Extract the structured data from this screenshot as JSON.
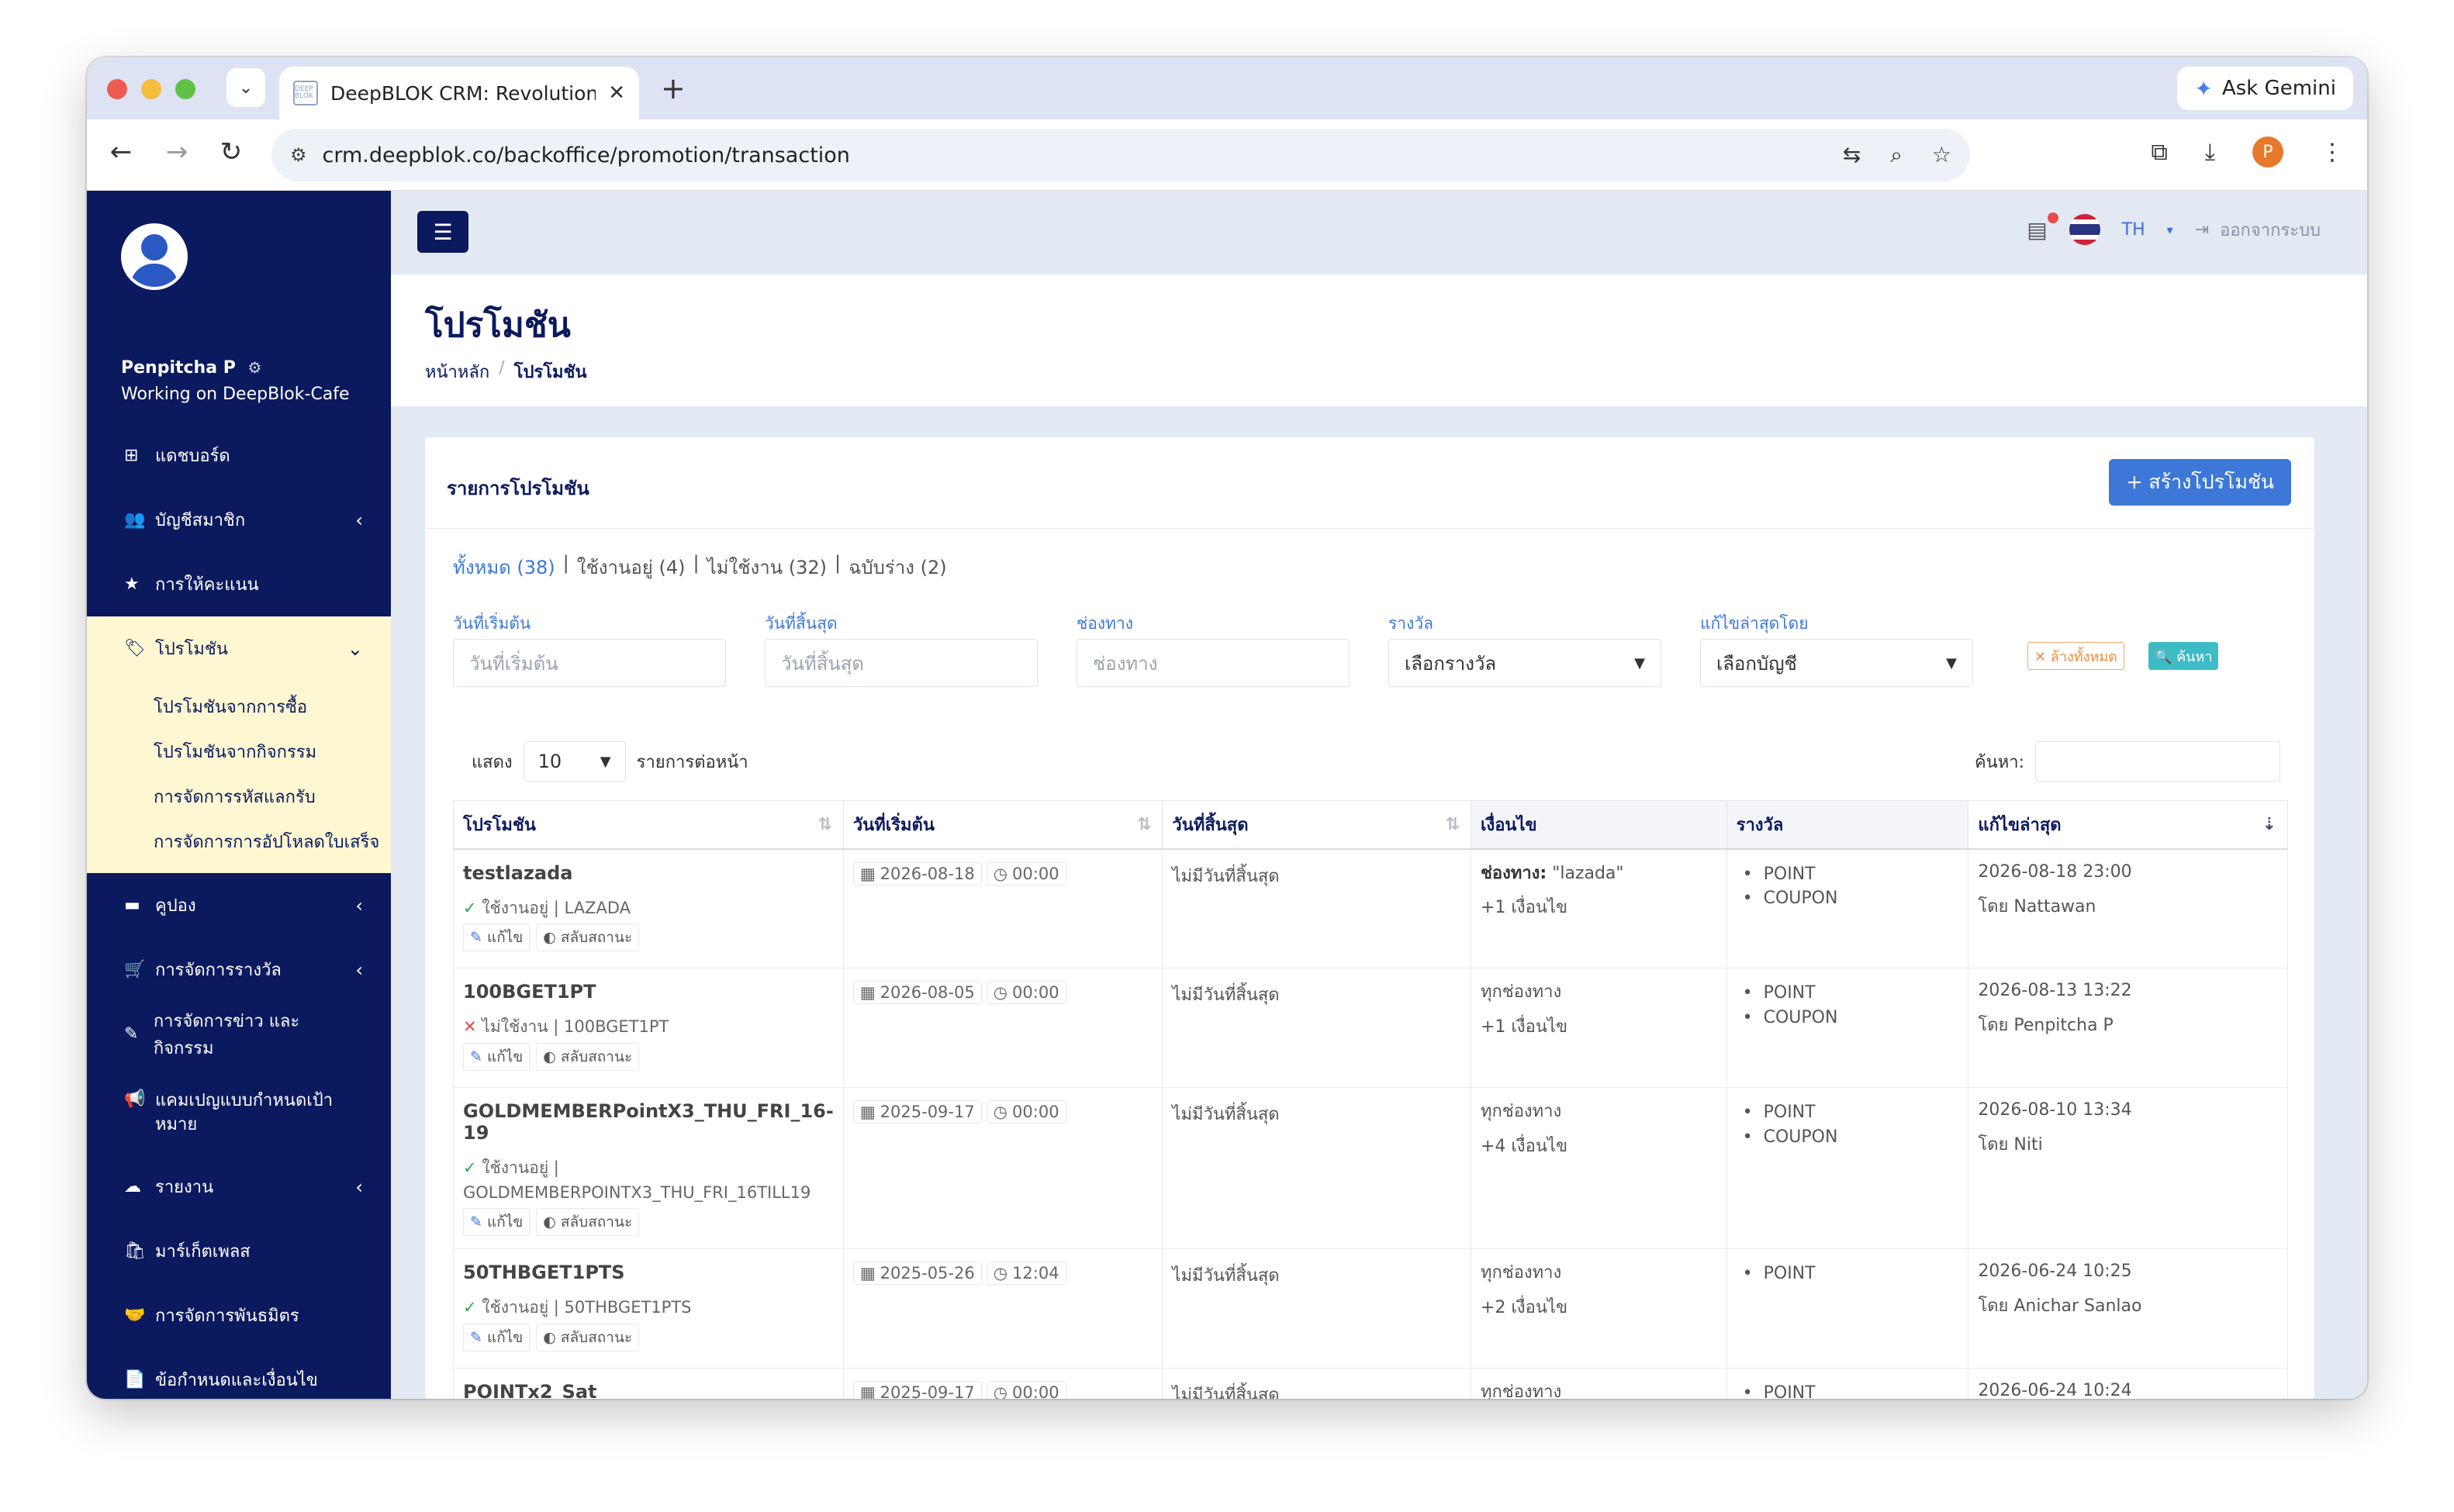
{
  "browser": {
    "tab_title": "DeepBLOK CRM: Revolutioniz",
    "favicon_text": "DEEP BLOK",
    "ask_gemini": "Ask Gemini",
    "url": "crm.deepblok.co/backoffice/promotion/transaction",
    "profile_initial": "P"
  },
  "sidebar": {
    "user_name": "Penpitcha P",
    "working_on": "Working on DeepBlok-Cafe",
    "items": [
      {
        "label": "แดชบอร์ด",
        "icon": "grid-icon",
        "glyph": "⊞",
        "chevron": ""
      },
      {
        "label": "บัญชีสมาชิก",
        "icon": "users-icon",
        "glyph": "👥",
        "chevron": "‹"
      },
      {
        "label": "การให้คะแนน",
        "icon": "star-icon",
        "glyph": "★",
        "chevron": ""
      },
      {
        "label": "โปรโมชัน",
        "icon": "tag-icon",
        "glyph": "🏷",
        "chevron": "⌄"
      },
      {
        "label": "คูปอง",
        "icon": "ticket-icon",
        "glyph": "▬",
        "chevron": "‹"
      },
      {
        "label": "การจัดการรางวัล",
        "icon": "cart-icon",
        "glyph": "🛒",
        "chevron": "‹"
      },
      {
        "label": "การจัดการข่าว และ กิจกรรม",
        "icon": "edit-icon",
        "glyph": "✎",
        "chevron": ""
      },
      {
        "label": "แคมเปญแบบกำหนดเป้าหมาย",
        "icon": "megaphone-icon",
        "glyph": "📢",
        "chevron": ""
      },
      {
        "label": "รายงาน",
        "icon": "cloud-download-icon",
        "glyph": "☁",
        "chevron": "‹"
      },
      {
        "label": "มาร์เก็ตเพลส",
        "icon": "bag-icon",
        "glyph": "🛍",
        "chevron": ""
      },
      {
        "label": "การจัดการพันธมิตร",
        "icon": "handshake-icon",
        "glyph": "🤝",
        "chevron": ""
      },
      {
        "label": "ข้อกำหนดและเงื่อนไข",
        "icon": "file-icon",
        "glyph": "📄",
        "chevron": ""
      }
    ],
    "promotion_sub": [
      "โปรโมชันจากการซื้อ",
      "โปรโมชันจากกิจกรรม",
      "การจัดการรหัสแลกรับ",
      "การจัดการการอัปโหลดใบเสร็จ"
    ]
  },
  "topbar": {
    "lang": "TH",
    "logout": "ออกจากระบบ",
    "flag_colors": [
      "#d0223a",
      "#ffffff",
      "#2a3580",
      "#ffffff",
      "#d0223a"
    ]
  },
  "header": {
    "title": "โปรโมชัน",
    "breadcrumb_home": "หน้าหลัก",
    "breadcrumb_current": "โปรโมชัน"
  },
  "card": {
    "title": "รายการโปรโมชัน",
    "create_button": "+ สร้างโปรโมชัน",
    "filter_tabs": {
      "all": "ทั้งหมด (38)",
      "active": "ใช้งานอยู่ (4)",
      "inactive": "ไม่ใช้งาน (32)",
      "draft": "ฉบับร่าง (2)"
    },
    "filters": {
      "start_label": "วันที่เริ่มต้น",
      "start_placeholder": "วันที่เริ่มต้น",
      "end_label": "วันที่สิ้นสุด",
      "end_placeholder": "วันที่สิ้นสุด",
      "channel_label": "ช่องทาง",
      "channel_placeholder": "ช่องทาง",
      "reward_label": "รางวัล",
      "reward_value": "เลือกรางวัล",
      "editor_label": "แก้ไขล่าสุดโดย",
      "editor_value": "เลือกบัญชี",
      "clear": "✕ ล้างทั้งหมด",
      "search": "🔍 ค้นหา"
    },
    "show_label": "แสดง",
    "page_size": "10",
    "per_page_label": "รายการต่อหน้า",
    "search_label": "ค้นหา:"
  },
  "table": {
    "headers": [
      "โปรโมชัน",
      "วันที่เริ่มต้น",
      "วันที่สิ้นสุด",
      "เงื่อนไข",
      "รางวัล",
      "แก้ไขล่าสุด"
    ],
    "edit_label": "แก้ไข",
    "toggle_label": "สลับสถานะ",
    "rows": [
      {
        "name": "testlazada",
        "status_mark": "✓",
        "status_ok": true,
        "status": "ใช้งานอยู่ | LAZADA",
        "start_date": "2026-08-18",
        "start_time": "00:00",
        "end": "ไม่มีวันที่สิ้นสุด",
        "cond_key": "ช่องทาง:",
        "cond_val": " \"lazada\"",
        "cond_more": "+1 เงื่อนไข",
        "rewards": [
          "POINT",
          "COUPON"
        ],
        "updated": "2026-08-18 23:00",
        "by": "โดย Nattawan"
      },
      {
        "name": "100BGET1PT",
        "status_mark": "✕",
        "status_ok": false,
        "status": "ไม่ใช้งาน | 100BGET1PT",
        "start_date": "2026-08-05",
        "start_time": "00:00",
        "end": "ไม่มีวันที่สิ้นสุด",
        "cond_key": "",
        "cond_val": "ทุกช่องทาง",
        "cond_more": "+1 เงื่อนไข",
        "rewards": [
          "POINT",
          "COUPON"
        ],
        "updated": "2026-08-13 13:22",
        "by": "โดย Penpitcha P"
      },
      {
        "name": "GOLDMEMBERPointX3_THU_FRI_16-19",
        "status_mark": "✓",
        "status_ok": true,
        "status": "ใช้งานอยู่ | GOLDMEMBERPOINTX3_THU_FRI_16TILL19",
        "start_date": "2025-09-17",
        "start_time": "00:00",
        "end": "ไม่มีวันที่สิ้นสุด",
        "cond_key": "",
        "cond_val": "ทุกช่องทาง",
        "cond_more": "+4 เงื่อนไข",
        "rewards": [
          "POINT",
          "COUPON"
        ],
        "updated": "2026-08-10 13:34",
        "by": "โดย Niti"
      },
      {
        "name": "50THBGET1PTS",
        "status_mark": "✓",
        "status_ok": true,
        "status": "ใช้งานอยู่ | 50THBGET1PTS",
        "start_date": "2025-05-26",
        "start_time": "12:04",
        "end": "ไม่มีวันที่สิ้นสุด",
        "cond_key": "",
        "cond_val": "ทุกช่องทาง",
        "cond_more": "+2 เงื่อนไข",
        "rewards": [
          "POINT"
        ],
        "updated": "2026-06-24 10:25",
        "by": "โดย Anichar Sanlao"
      },
      {
        "name": "POINTx2_Sat",
        "status_mark": "",
        "status_ok": true,
        "status": "",
        "start_date": "2025-09-17",
        "start_time": "00:00",
        "end": "ไม่มีวันที่สิ้นสุด",
        "cond_key": "",
        "cond_val": "ทุกช่องทาง",
        "cond_more": "",
        "rewards": [
          "POINT"
        ],
        "updated": "2026-06-24 10:24",
        "by": ""
      }
    ]
  }
}
